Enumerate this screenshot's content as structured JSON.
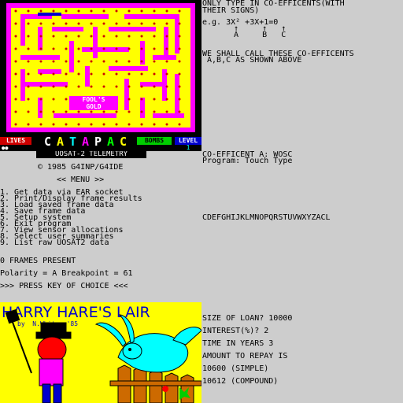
{
  "game": {
    "hud_lives": "LIVES",
    "hud_title_letters": [
      "C",
      "A",
      "T",
      "A",
      "P",
      "A",
      "C"
    ],
    "hud_title_colors": [
      "#ffffff",
      "#ffff00",
      "#00ffff",
      "#ff00ff",
      "#ffffff",
      "#00ff00",
      "#ffff00"
    ],
    "hud_bombs": "BOMBS",
    "hud_level": "LEVEL",
    "hud_level_value": "1",
    "fools_gold_line1": "FOOL'S",
    "fools_gold_line2": "GOLD",
    "colors": {
      "wall": "#ff00ff",
      "floor": "#ffff00",
      "dot": "#cd0000",
      "border": "#000000"
    }
  },
  "coefficients": {
    "line1": "ONLY TYPE IN CO-EFFICENTS(WITH",
    "line2": "THEIR SIGNS)",
    "example": "e.g. 3X² +3X+1=0",
    "arrows": "↑     ↑   ↑",
    "labels": "A     B   C",
    "line5": "WE SHALL CALL THESE CO-EFFICENTS",
    "line6": " A,B,C AS SHOWN ABOVE"
  },
  "telemetry": {
    "header": "UOSAT-2 TELEMETRY",
    "copyright": "© 1985 G4INP/G4IDE",
    "menu_title": "<< MENU >>",
    "menu_items": [
      "1. Get data via EAR socket",
      "2. Print/Display frame results",
      "3. Load saved frame data",
      "4. Save frame data",
      "5. Setup system",
      "6. Exit program",
      "7. View sensor allocations",
      "8. Select user summaries",
      "9. List raw UOSAT2 data"
    ],
    "frames": "0 FRAMES PRESENT",
    "polarity": "Polarity = A Breakpoint = 61",
    "prompt": ">>> PRESS KEY OF CHOICE <<<"
  },
  "charset": {
    "coef_a": "CO-EFFICENT A: WOSC",
    "program": "Program: Touch Type",
    "alphabet": "CDEFGHIJKLMNOPQRSTUVWXYZACL"
  },
  "harry": {
    "title": "HARRY HARE'S LAIR",
    "byline": "by  N.White  '85",
    "colors": {
      "sky": "#ffff00",
      "title": "#0000cd",
      "hare": "#00ffff",
      "fence": "#cd6a00"
    }
  },
  "loan": {
    "size": "SIZE OF LOAN? 10000",
    "interest": "INTEREST(%)? 2",
    "time": "TIME IN YEARS 3",
    "amount_label": "AMOUNT TO REPAY IS",
    "simple": "10600 (SIMPLE)",
    "compound": "10612 (COMPOUND)"
  }
}
